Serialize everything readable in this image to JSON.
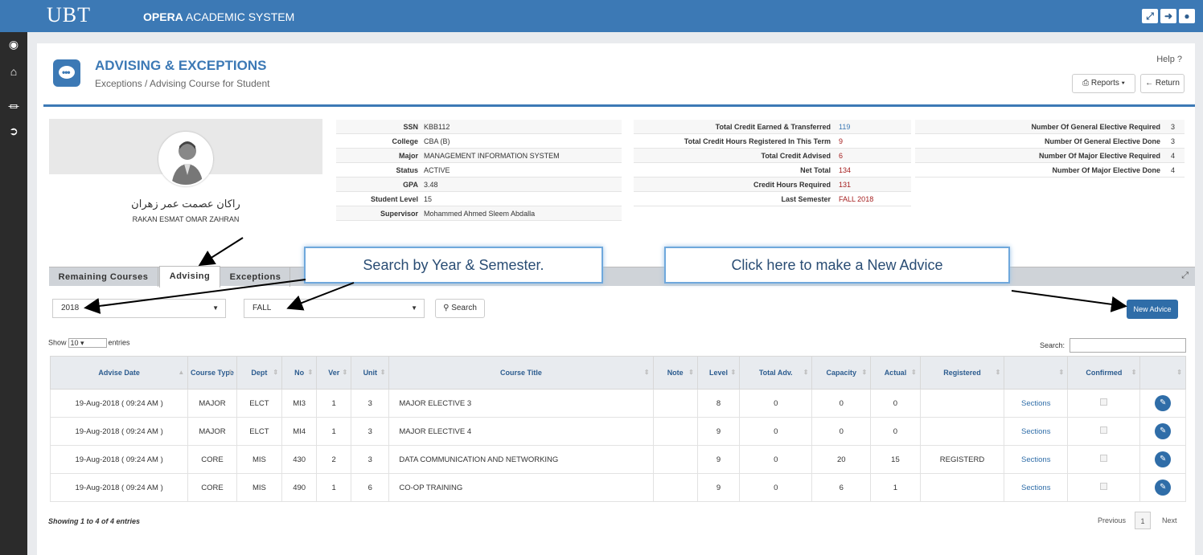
{
  "topbar": {
    "brand": "UBT",
    "system_bold": "OPERA",
    "system_rest": " ACADEMIC SYSTEM",
    "icons": [
      "expand-icon",
      "logout-icon",
      "user-icon"
    ]
  },
  "rail": {
    "icons": [
      "user-circle-icon",
      "home-icon",
      "bank-icon",
      "arrow-circle-icon"
    ]
  },
  "header": {
    "title": "ADVISING & EXCEPTIONS",
    "subtitle": "Exceptions / Advising Course for Student",
    "help": "Help ?",
    "reports": "Reports",
    "return": "Return"
  },
  "student": {
    "name_ar": "راكان عصمت عمر زهران",
    "name_en": "RAKAN ESMAT OMAR ZAHRAN"
  },
  "info1": [
    {
      "k": "SSN",
      "v": "KBB112"
    },
    {
      "k": "College",
      "v": "CBA (B)"
    },
    {
      "k": "Major",
      "v": "MANAGEMENT INFORMATION SYSTEM"
    },
    {
      "k": "Status",
      "v": "ACTIVE"
    },
    {
      "k": "GPA",
      "v": "3.48"
    },
    {
      "k": "Student Level",
      "v": "15"
    },
    {
      "k": "Supervisor",
      "v": "Mohammed Ahmed Sleem Abdalla"
    }
  ],
  "info2": [
    {
      "k": "Total Credit Earned & Transferred",
      "v": "119"
    },
    {
      "k": "Total Credit Hours Registered In This Term",
      "v": "9"
    },
    {
      "k": "Total Credit Advised",
      "v": "6"
    },
    {
      "k": "Net Total",
      "v": "134"
    },
    {
      "k": "Credit Hours Required",
      "v": "131"
    },
    {
      "k": "Last Semester",
      "v": "FALL 2018"
    }
  ],
  "info3": [
    {
      "k": "Number Of General Elective Required",
      "v": "3"
    },
    {
      "k": "Number Of General Elective Done",
      "v": "3"
    },
    {
      "k": "Number Of Major Elective Required",
      "v": "4"
    },
    {
      "k": "Number Of Major Elective Done",
      "v": "4"
    }
  ],
  "tabs": [
    "Remaining Courses",
    "Advising",
    "Exceptions"
  ],
  "filters": {
    "year": "2018",
    "semester": "FALL",
    "search": "Search",
    "new_advice": "New Advice"
  },
  "table_ctrl": {
    "show": "Show",
    "entries_value": "10",
    "entries": "entries",
    "search": "Search:"
  },
  "columns": [
    "Advise Date",
    "Course Type",
    "Dept",
    "No",
    "Ver",
    "Unit",
    "Course Title",
    "Note",
    "Level",
    "Total Adv.",
    "Capacity",
    "Actual",
    "Registered",
    "",
    "Confirmed",
    ""
  ],
  "rows": [
    {
      "date": "19-Aug-2018 ( 09:24 AM )",
      "type": "MAJOR",
      "dept": "ELCT",
      "no": "MI3",
      "ver": "1",
      "unit": "3",
      "title": "MAJOR ELECTIVE 3",
      "note": "",
      "level": "8",
      "total_adv": "0",
      "capacity": "0",
      "actual": "0",
      "registered": "",
      "sections": "Sections"
    },
    {
      "date": "19-Aug-2018 ( 09:24 AM )",
      "type": "MAJOR",
      "dept": "ELCT",
      "no": "MI4",
      "ver": "1",
      "unit": "3",
      "title": "MAJOR ELECTIVE 4",
      "note": "",
      "level": "9",
      "total_adv": "0",
      "capacity": "0",
      "actual": "0",
      "registered": "",
      "sections": "Sections"
    },
    {
      "date": "19-Aug-2018 ( 09:24 AM )",
      "type": "CORE",
      "dept": "MIS",
      "no": "430",
      "ver": "2",
      "unit": "3",
      "title": "DATA COMMUNICATION AND NETWORKING",
      "note": "",
      "level": "9",
      "total_adv": "0",
      "capacity": "20",
      "actual": "15",
      "registered": "REGISTERD",
      "sections": "Sections"
    },
    {
      "date": "19-Aug-2018 ( 09:24 AM )",
      "type": "CORE",
      "dept": "MIS",
      "no": "490",
      "ver": "1",
      "unit": "6",
      "title": "CO-OP TRAINING",
      "note": "",
      "level": "9",
      "total_adv": "0",
      "capacity": "6",
      "actual": "1",
      "registered": "",
      "sections": "Sections"
    }
  ],
  "footer": {
    "showing": "Showing 1 to 4 of 4 entries",
    "previous": "Previous",
    "page": "1",
    "next": "Next"
  },
  "callouts": {
    "search": "Search by Year & Semester.",
    "new": "Click here to make a New Advice"
  }
}
